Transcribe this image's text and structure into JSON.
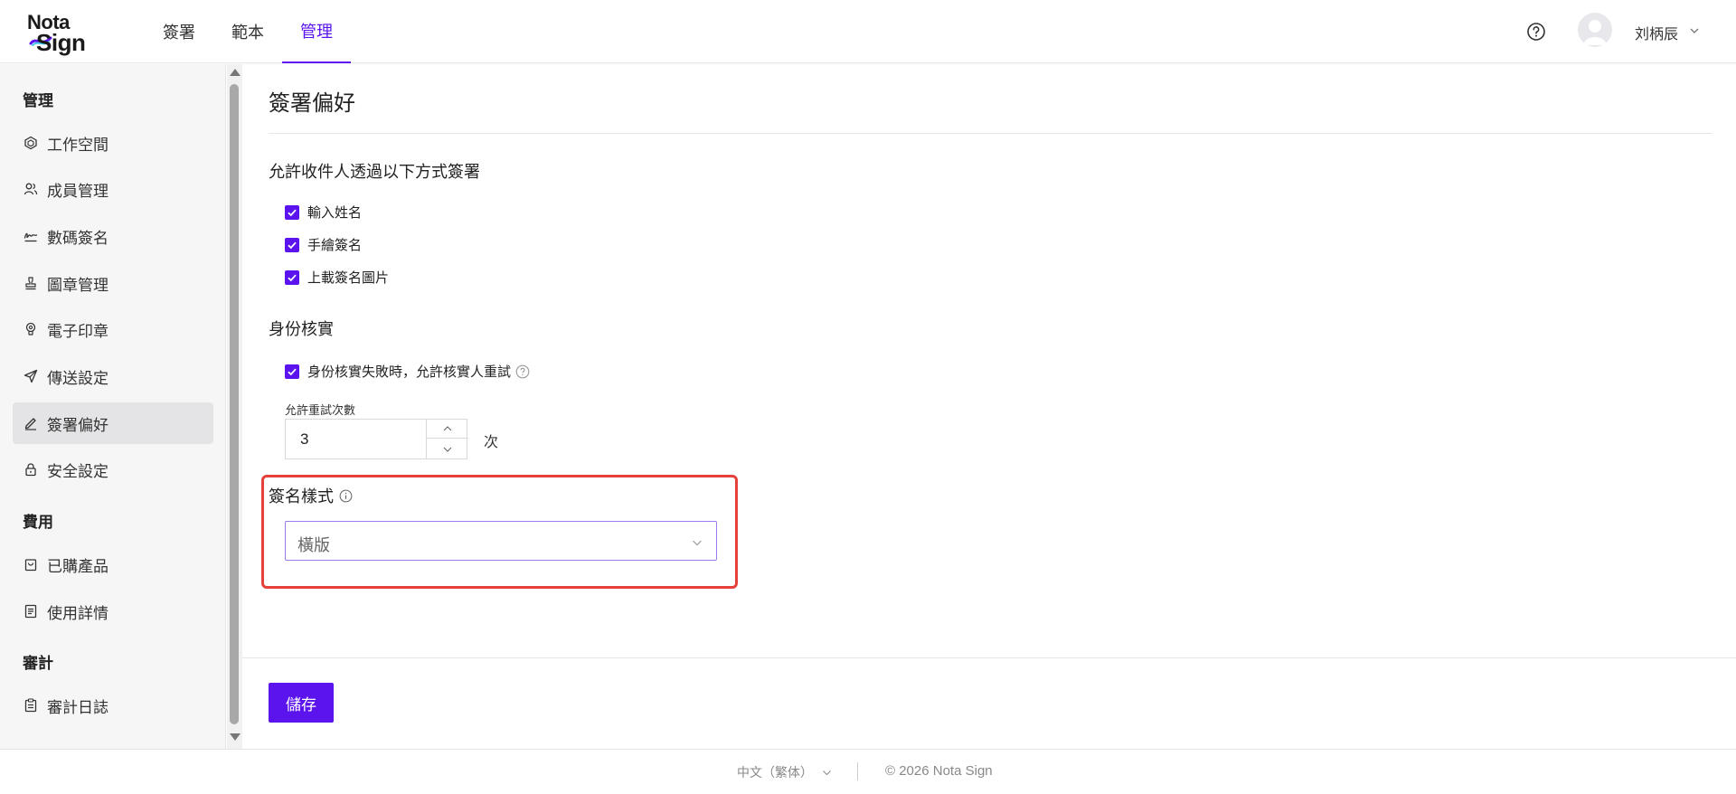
{
  "brand": {
    "line1": "Nota",
    "line2": "Sign",
    "accent": "#5b14ee"
  },
  "topnav": {
    "tabs": [
      {
        "label": "簽署"
      },
      {
        "label": "範本"
      },
      {
        "label": "管理",
        "active": true
      }
    ],
    "user_name": "刘柄辰"
  },
  "sidebar": {
    "sections": [
      {
        "title": "管理",
        "items": [
          {
            "label": "工作空間",
            "icon": "workspace-icon"
          },
          {
            "label": "成員管理",
            "icon": "members-icon"
          },
          {
            "label": "數碼簽名",
            "icon": "signature-icon"
          },
          {
            "label": "圖章管理",
            "icon": "stamp-icon"
          },
          {
            "label": "電子印章",
            "icon": "seal-icon"
          },
          {
            "label": "傳送設定",
            "icon": "send-icon"
          },
          {
            "label": "簽署偏好",
            "icon": "pen-icon",
            "active": true
          },
          {
            "label": "安全設定",
            "icon": "lock-icon"
          }
        ]
      },
      {
        "title": "費用",
        "items": [
          {
            "label": "已購產品",
            "icon": "bag-icon"
          },
          {
            "label": "使用詳情",
            "icon": "document-icon"
          }
        ]
      },
      {
        "title": "審計",
        "items": [
          {
            "label": "審計日誌",
            "icon": "clipboard-icon"
          }
        ]
      }
    ]
  },
  "main": {
    "title": "簽署偏好",
    "sign_methods": {
      "label": "允許收件人透過以下方式簽署",
      "options": [
        {
          "label": "輸入姓名",
          "checked": true
        },
        {
          "label": "手繪簽名",
          "checked": true
        },
        {
          "label": "上載簽名圖片",
          "checked": true
        }
      ]
    },
    "identity": {
      "label": "身份核實",
      "retry_option": {
        "label": "身份核實失敗時，允許核實人重試",
        "checked": true
      },
      "retry_count_label": "允許重試次數",
      "retry_count_value": "3",
      "retry_unit": "次"
    },
    "signature_style": {
      "label": "簽名樣式",
      "selected": "橫版"
    },
    "save_label": "儲存"
  },
  "footer": {
    "language": "中文（繁体）",
    "copyright": "© 2026 Nota Sign"
  },
  "colors": {
    "accent": "#5b14ee",
    "highlight": "#e5403a"
  }
}
